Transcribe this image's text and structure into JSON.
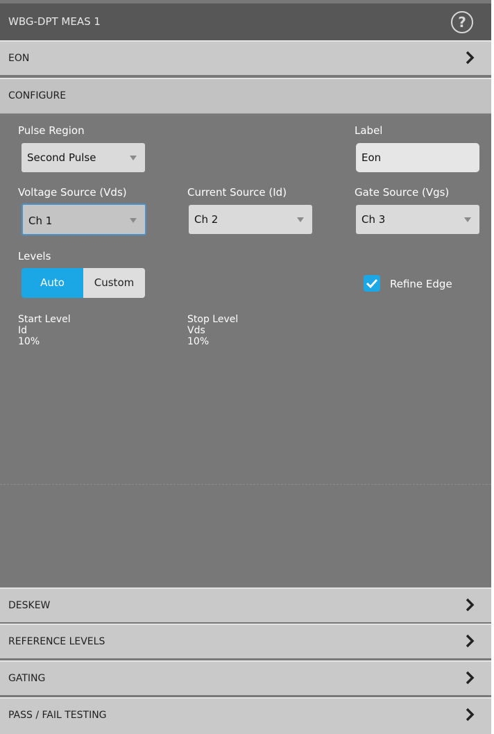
{
  "window": {
    "title": "WBG-DPT MEAS 1",
    "help_icon": "help-icon"
  },
  "sections": {
    "eon": "EON",
    "configure": "CONFIGURE",
    "deskew": "DESKEW",
    "reference_levels": "REFERENCE LEVELS",
    "gating": "GATING",
    "pass_fail": "PASS / FAIL TESTING"
  },
  "configure": {
    "pulse_region": {
      "label": "Pulse Region",
      "value": "Second Pulse"
    },
    "label_field": {
      "label": "Label",
      "value": "Eon"
    },
    "voltage_source": {
      "label": "Voltage Source (Vds)",
      "value": "Ch 1"
    },
    "current_source": {
      "label": "Current Source (Id)",
      "value": "Ch 2"
    },
    "gate_source": {
      "label": "Gate Source (Vgs)",
      "value": "Ch 3"
    },
    "levels": {
      "label": "Levels",
      "auto": "Auto",
      "custom": "Custom",
      "selected": "Auto"
    },
    "refine_edge": {
      "label": "Refine Edge",
      "checked": true
    },
    "start_level": {
      "title": "Start Level",
      "source": "Id",
      "percent": "10%"
    },
    "stop_level": {
      "title": "Stop Level",
      "source": "Vds",
      "percent": "10%"
    }
  },
  "colors": {
    "accent": "#1ba7e6",
    "panel_bg": "#787878",
    "header_bg": "#c9c9c9",
    "titlebar_bg": "#575757"
  }
}
